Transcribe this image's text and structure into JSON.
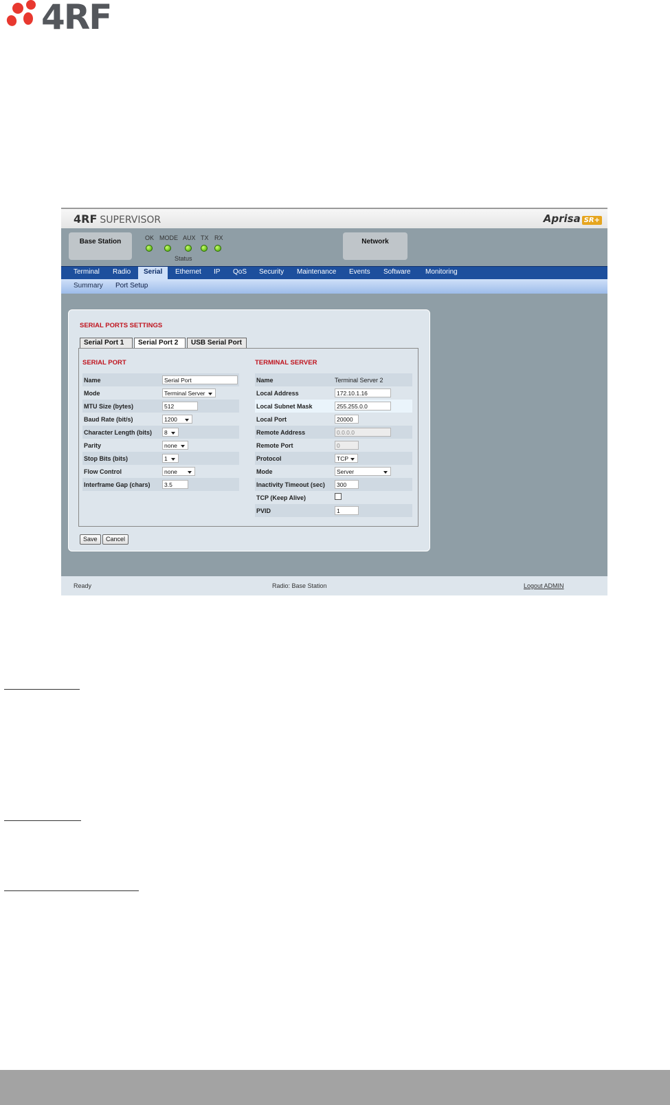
{
  "logo": {
    "text": "4RF"
  },
  "app": {
    "brand_mark": "4RF",
    "brand_name": "SUPERVISOR",
    "product": "Aprisa",
    "product_badge": "SR+",
    "station_label": "Base Station",
    "network_label": "Network",
    "leds": [
      "OK",
      "MODE",
      "AUX",
      "TX",
      "RX"
    ],
    "status_label": "Status",
    "tabs": [
      "Terminal",
      "Radio",
      "Serial",
      "Ethernet",
      "IP",
      "QoS",
      "Security",
      "Maintenance",
      "Events",
      "Software",
      "Monitoring"
    ],
    "active_tab": "Serial",
    "subtabs": [
      "Summary",
      "Port Setup"
    ],
    "active_subtab": "Port Setup"
  },
  "panel": {
    "title": "SERIAL PORTS SETTINGS",
    "port_tabs": [
      "Serial Port 1",
      "Serial Port 2",
      "USB Serial Port"
    ],
    "active_port_tab": "Serial Port 2",
    "serial_port": {
      "title": "SERIAL PORT",
      "rows": [
        {
          "label": "Name",
          "value": "Serial Port"
        },
        {
          "label": "Mode",
          "value": "Terminal Server"
        },
        {
          "label": "MTU Size (bytes)",
          "value": "512"
        },
        {
          "label": "Baud Rate (bit/s)",
          "value": "1200"
        },
        {
          "label": "Character Length (bits)",
          "value": "8"
        },
        {
          "label": "Parity",
          "value": "none"
        },
        {
          "label": "Stop Bits (bits)",
          "value": "1"
        },
        {
          "label": "Flow Control",
          "value": "none"
        },
        {
          "label": "Interframe Gap (chars)",
          "value": "3.5"
        }
      ]
    },
    "terminal_server": {
      "title": "TERMINAL SERVER",
      "rows": [
        {
          "label": "Name",
          "value": "Terminal Server 2"
        },
        {
          "label": "Local Address",
          "value": "172.10.1.16"
        },
        {
          "label": "Local Subnet Mask",
          "value": "255.255.0.0"
        },
        {
          "label": "Local Port",
          "value": "20000"
        },
        {
          "label": "Remote Address",
          "value": "0.0.0.0"
        },
        {
          "label": "Remote Port",
          "value": "0"
        },
        {
          "label": "Protocol",
          "value": "TCP"
        },
        {
          "label": "Mode",
          "value": "Server"
        },
        {
          "label": "Inactivity Timeout (sec)",
          "value": "300"
        },
        {
          "label": "TCP (Keep Alive)",
          "value": ""
        },
        {
          "label": "PVID",
          "value": "1"
        }
      ]
    },
    "save_label": "Save",
    "cancel_label": "Cancel"
  },
  "footer": {
    "status": "Ready",
    "radio": "Radio: Base Station",
    "logout": "Logout ADMIN"
  },
  "colors": {
    "tabbar": "#1d4f9d",
    "frame_bg": "#8f9ea6",
    "section_title": "#c0141e",
    "logo_red": "#e8382f"
  }
}
